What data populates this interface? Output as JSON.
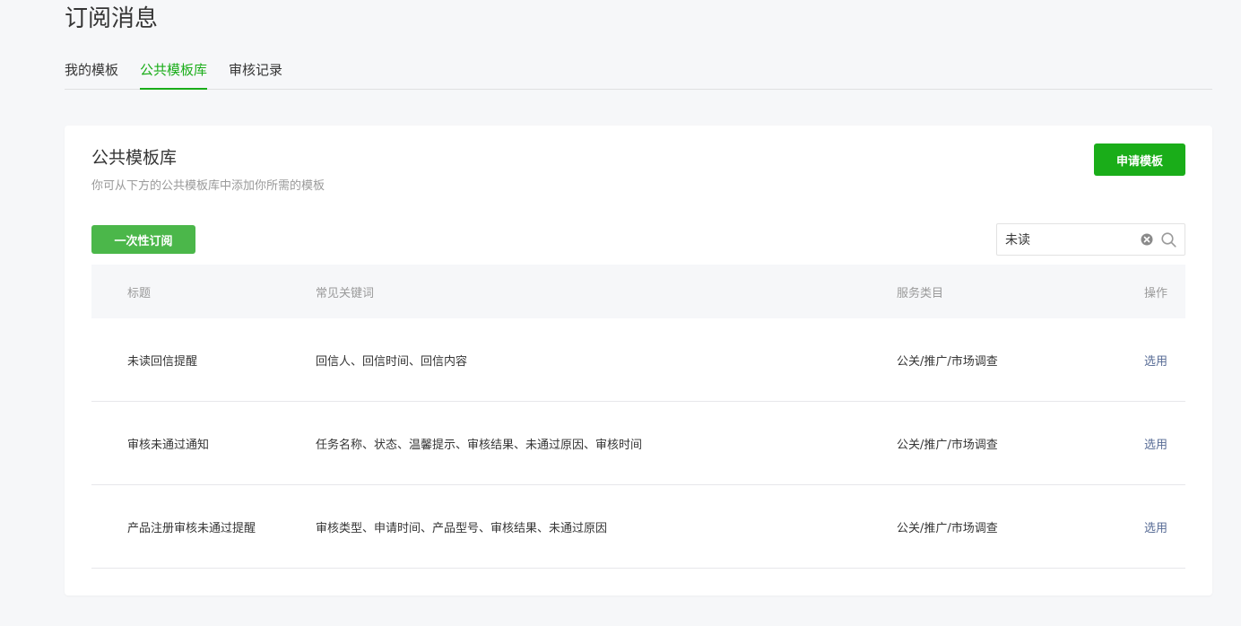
{
  "page": {
    "title": "订阅消息"
  },
  "tabs": [
    {
      "label": "我的模板"
    },
    {
      "label": "公共模板库"
    },
    {
      "label": "审核记录"
    }
  ],
  "active_tab": "公共模板库",
  "card": {
    "title": "公共模板库",
    "description": "你可从下方的公共模板库中添加你所需的模板",
    "apply_button": "申请模板",
    "once_button": "一次性订阅"
  },
  "search": {
    "value": "未读"
  },
  "table": {
    "headers": {
      "title": "标题",
      "keywords": "常见关键词",
      "category": "服务类目",
      "action": "操作"
    },
    "rows": [
      {
        "title": "未读回信提醒",
        "keywords": "回信人、回信时间、回信内容",
        "category": "公关/推广/市场调查",
        "action": "选用"
      },
      {
        "title": "审核未通过通知",
        "keywords": "任务名称、状态、温馨提示、审核结果、未通过原因、审核时间",
        "category": "公关/推广/市场调查",
        "action": "选用"
      },
      {
        "title": "产品注册审核未通过提醒",
        "keywords": "审核类型、申请时间、产品型号、审核结果、未通过原因",
        "category": "公关/推广/市场调查",
        "action": "选用"
      }
    ]
  },
  "colors": {
    "accent": "#1aad19",
    "once_button": "#4bb74a",
    "link": "#576b95"
  }
}
